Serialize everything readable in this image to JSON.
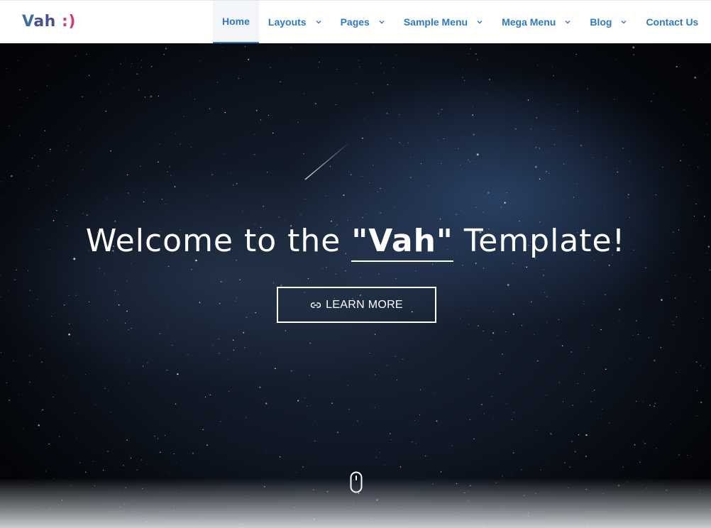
{
  "brand": {
    "logo_v": "V",
    "logo_ah": "ah",
    "logo_smile": ":)"
  },
  "nav": {
    "items": [
      {
        "label": "Home",
        "active": true,
        "has_dropdown": false
      },
      {
        "label": "Layouts",
        "has_dropdown": true
      },
      {
        "label": "Pages",
        "has_dropdown": true
      },
      {
        "label": "Sample Menu",
        "has_dropdown": true
      },
      {
        "label": "Mega Menu",
        "has_dropdown": true
      },
      {
        "label": "Blog",
        "has_dropdown": true
      },
      {
        "label": "Contact Us",
        "has_dropdown": false
      }
    ]
  },
  "hero": {
    "title_prefix": "Welcome to the ",
    "title_accent": "\"Vah\"",
    "title_suffix": " Template!",
    "button_label": "LEARN MORE",
    "button_icon": "link-icon",
    "scroll_icon": "mouse-icon"
  },
  "colors": {
    "nav_link": "#2f79c6",
    "logo_v": "#3f6ea0",
    "logo_ah": "#4b4f8f",
    "logo_smile": "#d43a78",
    "hero_text": "#ffffff"
  }
}
